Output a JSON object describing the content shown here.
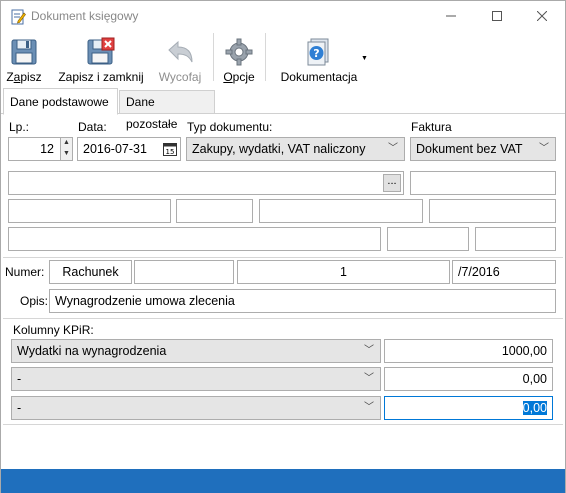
{
  "window": {
    "title": "Dokument księgowy"
  },
  "toolbar": {
    "save_pre": "Z",
    "save_u": "a",
    "save_post": "pisz",
    "save_close": "Zapisz i zamknij",
    "undo": "Wycofaj",
    "options_u": "O",
    "options_post": "pcje",
    "docs": "Dokumentacja"
  },
  "tabs": [
    {
      "label": "Dane podstawowe"
    },
    {
      "label": "Dane pozostałe"
    }
  ],
  "form": {
    "lp_label": "Lp.:",
    "lp_value": "12",
    "data_label": "Data:",
    "data_value": "2016-07-31",
    "typ_label": "Typ dokumentu:",
    "typ_value": "Zakupy, wydatki, VAT naliczony",
    "faktura_label": "Faktura",
    "faktura_value": "Dokument bez VAT",
    "browse_label": "...",
    "numer_label": "Numer:",
    "numer_prefix": "Rachunek",
    "numer_value": "1",
    "numer_suffix": "/7/2016",
    "opis_label": "Opis:",
    "opis_value": "Wynagrodzenie umowa zlecenia"
  },
  "kpir": {
    "label": "Kolumny KPiR:",
    "rows": [
      {
        "column": "Wydatki na wynagrodzenia",
        "amount": "1000,00"
      },
      {
        "column": "-",
        "amount": "0,00"
      },
      {
        "column": "-",
        "amount": "0,00"
      }
    ]
  },
  "colors": {
    "status_bar": "#1f6fbd",
    "selection": "#0078d7"
  }
}
